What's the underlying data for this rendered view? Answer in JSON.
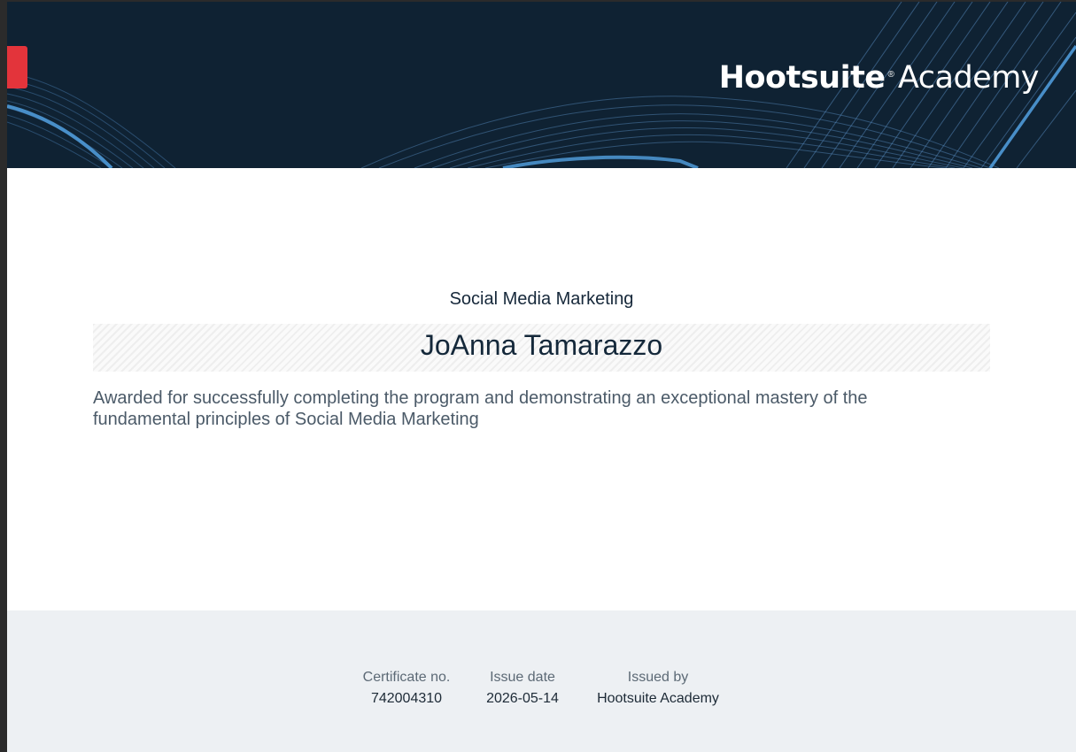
{
  "header": {
    "brand_main": "Hootsuite",
    "brand_reg": "®",
    "brand_sub": "Academy",
    "background_color": "#0f2233",
    "accent_color": "#e3343b"
  },
  "certificate": {
    "course": "Social Media Marketing",
    "recipient": "JoAnna Tamarazzo",
    "description": "Awarded for successfully completing the program and demonstrating an exceptional mastery of the fundamental principles of Social Media Marketing"
  },
  "footer": {
    "certificate_no_label": "Certificate no.",
    "certificate_no": "742004310",
    "issue_date_label": "Issue date",
    "issue_date": "2026-05-14",
    "issued_by_label": "Issued by",
    "issued_by": "Hootsuite Academy"
  }
}
